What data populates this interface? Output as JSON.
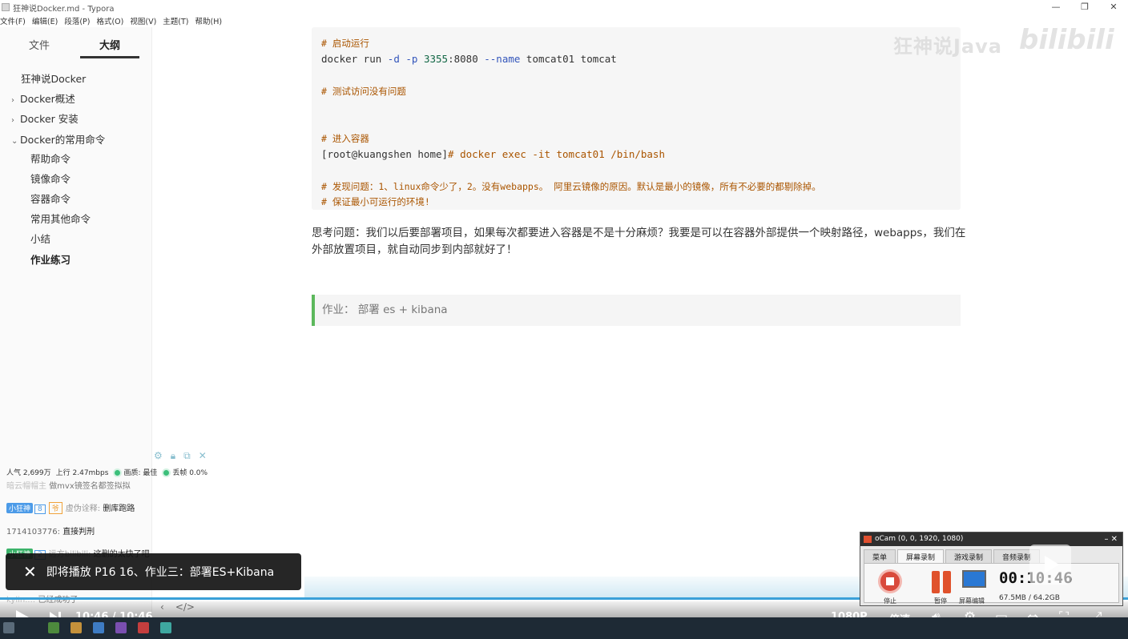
{
  "window": {
    "title": "狂神说Docker.md - Typora",
    "controls": [
      "—",
      "❐",
      "✕"
    ]
  },
  "menu": [
    "文件(F)",
    "编辑(E)",
    "段落(P)",
    "格式(O)",
    "视图(V)",
    "主题(T)",
    "帮助(H)"
  ],
  "sidebar": {
    "tabs": [
      "文件",
      "大纲"
    ],
    "outline": [
      {
        "label": "狂神说Docker",
        "arrow": ""
      },
      {
        "label": "Docker概述",
        "arrow": "›"
      },
      {
        "label": "Docker 安装",
        "arrow": "›"
      },
      {
        "label": "Docker的常用命令",
        "arrow": "⌄"
      },
      {
        "label": "帮助命令",
        "arrow": ""
      },
      {
        "label": "镜像命令",
        "arrow": ""
      },
      {
        "label": "容器命令",
        "arrow": ""
      },
      {
        "label": "常用其他命令",
        "arrow": ""
      },
      {
        "label": "小结",
        "arrow": ""
      },
      {
        "label": "作业练习",
        "arrow": ""
      }
    ]
  },
  "code": {
    "l1": "# 启动运行",
    "l2_cmd": "docker run ",
    "l2_f1": "-d",
    "l2_f2": "-p",
    "l2_port": "3355",
    "l2_port2": ":8080 ",
    "l2_f3": "--name",
    "l2_rest": " tomcat01 tomcat",
    "l3": "# 测试访问没有问题",
    "l4": "# 进入容器",
    "l5_prompt": "[root@kuangshen home]",
    "l5_cmd": "# docker exec -it tomcat01 /bin/bash",
    "l6": "# 发现问题：1、linux命令少了，2。没有webapps。 阿里云镜像的原因。默认是最小的镜像，所有不必要的都剔除掉。",
    "l7": "# 保证最小可运行的环境!"
  },
  "paragraph": "思考问题：我们以后要部署项目，如果每次都要进入容器是不是十分麻烦？我要是可以在容器外部提供一个映射路径，webapps，我们在外部放置项目，就自动同步到内部就好了！",
  "blockquote": "作业： 部署 es + kibana",
  "watermark": {
    "text": "狂神说Java",
    "logo": "bilibili"
  },
  "player": {
    "stats_popularity": "人气  2,699万",
    "stats_upload": "上行  2.47mbps",
    "stats_quality": "画质: 最佳",
    "stats_drop": "丢帧 0.0%",
    "icons": [
      "gear-icon",
      "lock-icon",
      "popout-icon",
      "close-icon"
    ],
    "chat": [
      {
        "user": "暗云帽帽主",
        "msg": "做mvx镜签名都签拟拟"
      },
      {
        "badge": "小狂神",
        "level": "8",
        "gold": "爷",
        "user": "虚伪诠释:",
        "msg": "删库跑路"
      },
      {
        "user": "1714103776:",
        "msg": "直接判刑"
      },
      {
        "badge": "小狂神",
        "level": "2",
        "user": "远方bilibili:",
        "msg": "这删的太快了吧"
      },
      {
        "user": "kylin...:",
        "msg": "已经成功了"
      }
    ],
    "upnext": "即将播放 P16 16、作业三：部署ES+Kibana",
    "time": "10:46 / 10:46",
    "quality": "1080P",
    "speed": "倍速",
    "editor_ctrls": [
      "‹",
      "</>"
    ]
  },
  "ocam": {
    "title": "oCam (0, 0, 1920, 1080)",
    "tabs": [
      "菜单",
      "屏幕录制",
      "游戏录制",
      "音频录制"
    ],
    "timer": "00:10:46",
    "size": "67.5MB / 64.2GB",
    "labels": [
      "停止",
      "暂停",
      "屏幕编辑"
    ]
  },
  "colors": {
    "accent": "#3aa0d8",
    "quote_border": "#5cb85c",
    "comment": "#aa5500"
  }
}
